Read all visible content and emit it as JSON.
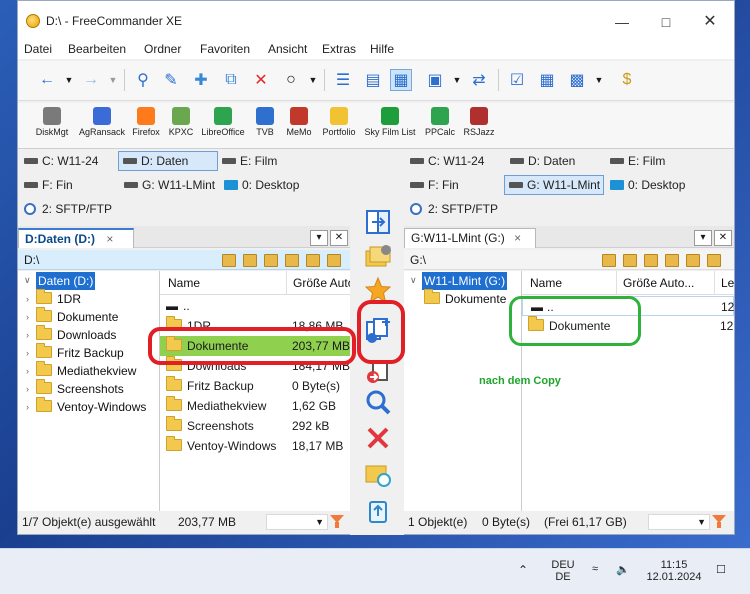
{
  "window": {
    "title": "D:\\ - FreeCommander XE",
    "min_icon": "minimize-icon",
    "max_icon": "maximize-icon",
    "close_icon": "close-icon"
  },
  "menu": [
    "Datei",
    "Bearbeiten",
    "Ordner",
    "Favoriten",
    "Ansicht",
    "Extras",
    "Hilfe"
  ],
  "tools": [
    {
      "label": "DiskMgt",
      "color": "#7a7a7a"
    },
    {
      "label": "AgRansack",
      "color": "#3b6bd6"
    },
    {
      "label": "Firefox",
      "color": "#ff7a1a"
    },
    {
      "label": "KPXC",
      "color": "#6aa84f"
    },
    {
      "label": "LibreOffice",
      "color": "#2ea44f"
    },
    {
      "label": "TVB",
      "color": "#2f6fce"
    },
    {
      "label": "MeMo",
      "color": "#c0392b"
    },
    {
      "label": "Portfolio",
      "color": "#f1c232"
    },
    {
      "label": "Sky Film List",
      "color": "#1e9e3a"
    },
    {
      "label": "PPCalc",
      "color": "#2ea44f"
    },
    {
      "label": "RSJazz",
      "color": "#b03030"
    }
  ],
  "left": {
    "drives": [
      "C: W11-24",
      "D: Daten",
      "E: Film",
      "F: Fin",
      "G: W11-LMint",
      "0: Desktop",
      "2: SFTP/FTP"
    ],
    "tab": "D:Daten (D:)",
    "tab_close": "×",
    "path": "D:\\",
    "tree_root": "Daten (D:)",
    "tree": [
      "1DR",
      "Dokumente",
      "Downloads",
      "Fritz Backup",
      "Mediathekview",
      "Screenshots",
      "Ventoy-Windows"
    ],
    "columns": [
      "Name",
      "Größe Auto"
    ],
    "files": [
      {
        "name": "..",
        "size": ""
      },
      {
        "name": "1DR",
        "size": "18,86 MB"
      },
      {
        "name": "Dokumente",
        "size": "203,77 MB"
      },
      {
        "name": "Downloads",
        "size": "184,17 MB"
      },
      {
        "name": "Fritz Backup",
        "size": "0 Byte(s)"
      },
      {
        "name": "Mediathekview",
        "size": "1,62 GB"
      },
      {
        "name": "Screenshots",
        "size": "292 kB"
      },
      {
        "name": "Ventoy-Windows",
        "size": "18,17 MB"
      }
    ],
    "status_count": "1/7 Objekt(e) ausgewählt",
    "status_size": "203,77 MB"
  },
  "right": {
    "drives": [
      "C: W11-24",
      "D: Daten",
      "E: Film",
      "F: Fin",
      "G: W11-LMint",
      "0: Desktop",
      "2: SFTP/FTP"
    ],
    "tab": "G:W11-LMint (G:)",
    "tab_close": "×",
    "path": "G:\\",
    "tree_root": "W11-LMint (G:)",
    "tree": [
      "Dokumente"
    ],
    "columns": [
      "Name",
      "Größe Auto...",
      "Le"
    ],
    "files": [
      {
        "name": "..",
        "size": "",
        "extra": "12"
      },
      {
        "name": "Dokumente",
        "size": "",
        "extra": "12"
      }
    ],
    "status_count": "1 Objekt(e)",
    "status_size": "0 Byte(s)",
    "status_free": "(Frei 61,17 GB)"
  },
  "annotation": {
    "note": "nach dem Copy",
    "red": "#e01f26",
    "green": "#2fb23a"
  },
  "taskbar": {
    "lang_top": "DEU",
    "lang_bottom": "DE",
    "time": "11:15",
    "date": "12.01.2024"
  },
  "panel_menu": "▾",
  "panel_close": "✕"
}
